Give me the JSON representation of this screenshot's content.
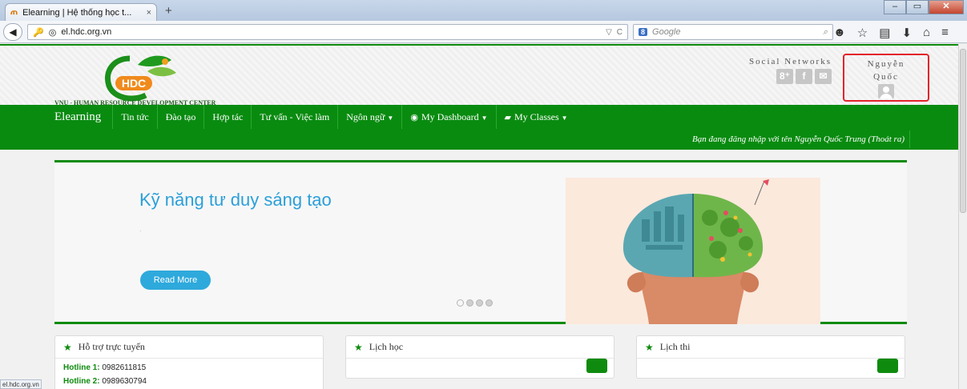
{
  "browser": {
    "tab_title": "Elearning | Hệ thống học t...",
    "tab_favicon": "ጠ",
    "tab_close": "×",
    "new_tab": "+",
    "url": "el.hdc.org.vn",
    "search_engine": "8",
    "search_placeholder": "Google",
    "status_url": "el.hdc.org.vn"
  },
  "header": {
    "logo_text": "HDC",
    "logo_caption": "VNU - HUMAN RESOURCE DEVELOPMENT CENTER",
    "social_title": "Social Networks",
    "social_icons": [
      "8⁺",
      "f",
      "✉"
    ],
    "user_first": "Nguyễn",
    "user_last": "Quốc"
  },
  "menu": {
    "brand": "Elearning",
    "items": [
      "Tin tức",
      "Đào tạo",
      "Hợp tác",
      "Tư vấn - Việc làm",
      "Ngôn ngữ",
      "My Dashboard",
      "My Classes"
    ],
    "login_note": "Bạn đang đăng nhập với tên Nguyễn Quốc Trung (Thoát ra)"
  },
  "slider": {
    "title": "Kỹ năng tư duy sáng tạo",
    "dot": ".",
    "read_more": "Read More",
    "active_dot": 0,
    "dots": 4
  },
  "panels": [
    {
      "title": "Hỗ trợ trực tuyến",
      "hotline1_label": "Hotline 1",
      "hotline1": "0982611815",
      "hotline2_label": "Hotline 2",
      "hotline2": "0989630794"
    },
    {
      "title": "Lịch học"
    },
    {
      "title": "Lịch thi"
    }
  ],
  "colors": {
    "brand_green": "#098b10",
    "accent_blue": "#2ea9dc",
    "highlight_red": "#e4232b"
  }
}
